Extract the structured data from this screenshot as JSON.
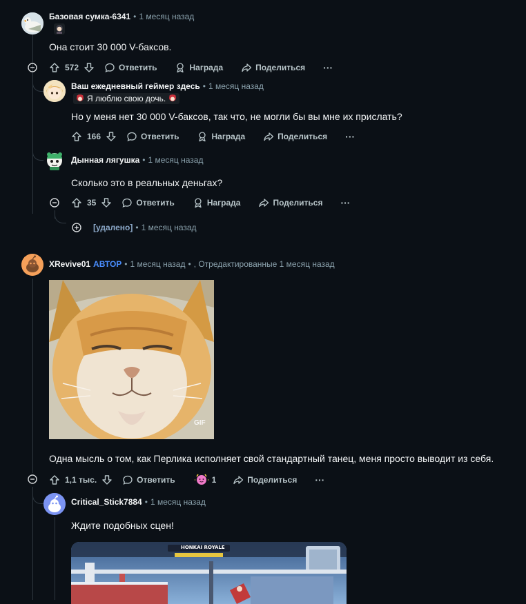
{
  "comments": [
    {
      "username": "Базовая сумка-6341",
      "time": "1 месяц назад",
      "text": "Она стоит 30 000 V-баксов.",
      "votes": "572",
      "reply": "Ответить",
      "award": "Награда",
      "share": "Поделиться",
      "more": "···"
    },
    {
      "username": "Ваш ежедневный геймер здесь",
      "time": "1 месяц назад",
      "flair": "Я люблю свою дочь.",
      "text": "Но у меня нет 30 000 V-баксов, так что, не могли бы вы мне их прислать?",
      "votes": "166",
      "reply": "Ответить",
      "award": "Награда",
      "share": "Поделиться",
      "more": "···"
    },
    {
      "username": "Дынная лягушка",
      "time": "1 месяц назад",
      "text": "Сколько это в реальных деньгах?",
      "votes": "35",
      "reply": "Ответить",
      "award": "Награда",
      "share": "Поделиться",
      "more": "···"
    },
    {
      "username": "[удалено]",
      "time": "1 месяц назад"
    },
    {
      "username": "XRevive01",
      "op": "АВТОР",
      "time": "1 месяц назад",
      "edited": ", Отредактированные 1 месяц назад",
      "gif_label": "GIF",
      "text": "Одна мысль о том, как Перлика исполняет свой стандартный танец, меня просто выводит из себя.",
      "votes": "1,1 тыс.",
      "reply": "Ответить",
      "award_count": "1",
      "share": "Поделиться",
      "more": "···"
    },
    {
      "username": "Critical_Stick7884",
      "time": "1 месяц назад",
      "text": "Ждите подобных сцен!",
      "game_banner": "HONKAI ROYALE"
    }
  ]
}
